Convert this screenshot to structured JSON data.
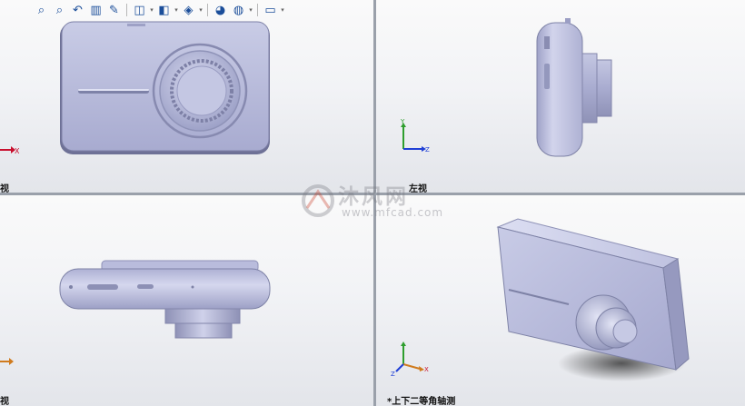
{
  "views": {
    "front": {
      "label": "视"
    },
    "left": {
      "label": "左视"
    },
    "top": {
      "label": "视"
    },
    "iso": {
      "label": "*上下二等角轴测"
    }
  },
  "triad": {
    "x": "X",
    "y": "Y",
    "z": "Z"
  },
  "watermark": {
    "text": "沐风网",
    "url": "www.mfcad.com"
  },
  "toolbar": {
    "buttons": [
      {
        "name": "zoom-to-fit-icon",
        "glyph": "⌕"
      },
      {
        "name": "zoom-to-area-icon",
        "glyph": "⌕"
      },
      {
        "name": "previous-view-icon",
        "glyph": "↶"
      },
      {
        "name": "section-view-icon",
        "glyph": "▥"
      },
      {
        "name": "dynamic-annotation-icon",
        "glyph": "✎"
      },
      {
        "name": "view-orientation-icon",
        "glyph": "◫"
      },
      {
        "name": "display-style-icon",
        "glyph": "◧"
      },
      {
        "name": "hide-show-items-icon",
        "glyph": "◈"
      },
      {
        "name": "edit-appearance-icon",
        "glyph": "◕"
      },
      {
        "name": "apply-scene-icon",
        "glyph": "◍"
      },
      {
        "name": "view-settings-icon",
        "glyph": "▭"
      }
    ]
  },
  "colors": {
    "model": "#b6b9d6",
    "model_dark": "#8c8fb0",
    "triad_x": "#c8102e",
    "triad_y": "#2e9e2e",
    "triad_z": "#1f3fd6"
  }
}
